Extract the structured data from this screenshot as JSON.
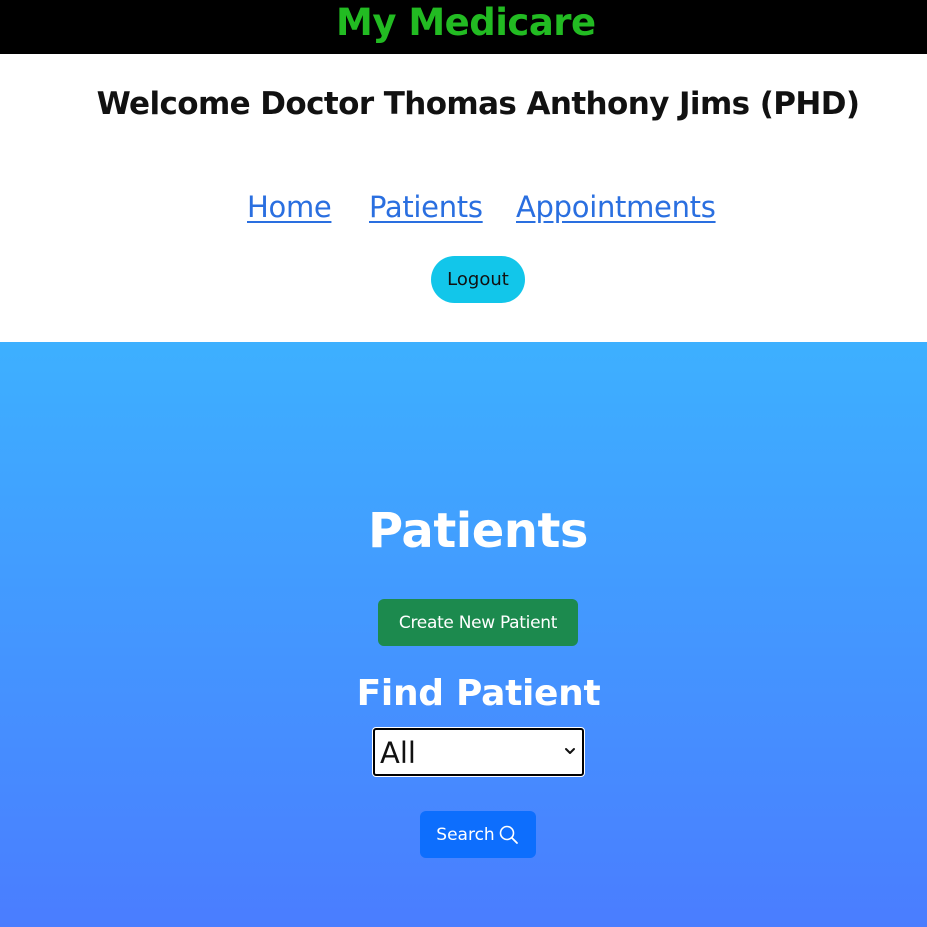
{
  "header": {
    "brand": "My Medicare",
    "brand_color": "#22bb22"
  },
  "welcome": {
    "text": "Welcome Doctor Thomas Anthony Jims (PHD)"
  },
  "nav": {
    "home": "Home",
    "patients": "Patients",
    "appointments": "Appointments"
  },
  "logout": {
    "label": "Logout"
  },
  "main": {
    "title": "Patients",
    "create_label": "Create New Patient",
    "find_title": "Find Patient",
    "filter": {
      "selected": "All"
    },
    "search_label": "Search",
    "search_icon": "search-icon"
  },
  "colors": {
    "topbar": "#000000",
    "logout_bg": "#12c6ea",
    "create_bg": "#1c8a4e",
    "search_bg": "#0d6efd",
    "link": "#2a6fe0",
    "hero_gradient_top": "#3db0ff",
    "hero_gradient_bottom": "#4a7dff"
  }
}
